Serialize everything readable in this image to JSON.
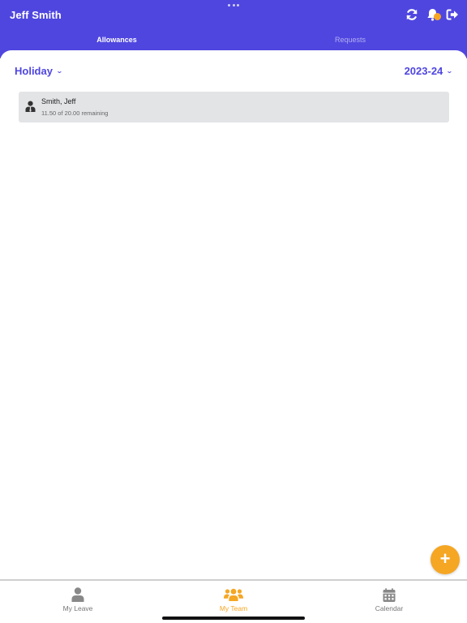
{
  "header": {
    "title": "Jeff Smith",
    "icons": [
      "refresh-icon",
      "bell-icon",
      "logout-icon"
    ],
    "accent_color": "#4f46e0",
    "badge_color": "#f5a623"
  },
  "tabs": [
    {
      "label": "Allowances",
      "active": true
    },
    {
      "label": "Requests",
      "active": false
    }
  ],
  "filters": {
    "leave_type": "Holiday",
    "year": "2023-24"
  },
  "allowances": [
    {
      "name": "Smith, Jeff",
      "remaining": "11.50 of 20.00 remaining",
      "icon": "person-tie-icon"
    }
  ],
  "fab": {
    "icon": "plus-icon",
    "label": "+",
    "color": "#f5a623"
  },
  "bottom_nav": [
    {
      "label": "My Leave",
      "icon": "person-icon",
      "active": false
    },
    {
      "label": "My Team",
      "icon": "team-icon",
      "active": true
    },
    {
      "label": "Calendar",
      "icon": "calendar-icon",
      "active": false
    }
  ]
}
